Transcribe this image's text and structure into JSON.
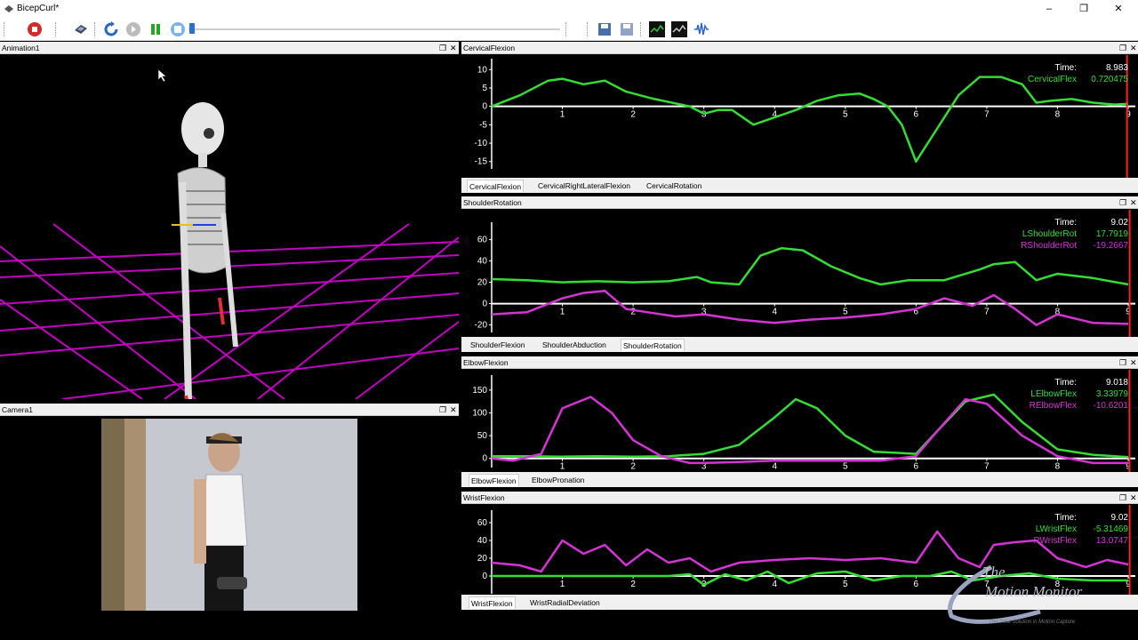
{
  "window": {
    "title": "BicepCurl*"
  },
  "colors": {
    "green": "#33dd33",
    "magenta": "#d633d6",
    "red": "#ff2020",
    "grid": "#c400c4"
  },
  "toolbar": {
    "icons": [
      "record-icon",
      "settings-tool-icon",
      "refresh-icon",
      "play-icon",
      "pause-icon",
      "stop-icon",
      "save-icon",
      "save-as-icon",
      "graph-icon",
      "graph-add-icon",
      "waveform-icon"
    ]
  },
  "panels": {
    "animation": {
      "title": "Animation1"
    },
    "camera": {
      "title": "Camera1"
    },
    "cervical": {
      "title": "CervicalFlexion",
      "time_label": "Time:",
      "time_value": "8.983",
      "legend": [
        {
          "name": "CervicalFlex",
          "value": "0.720475",
          "color": "#33dd33"
        }
      ],
      "tabs": [
        "CervicalFlexion",
        "CervicalRightLateralFlexion",
        "CervicalRotation"
      ],
      "active_tab": 0,
      "y_ticks": [
        "10",
        "5",
        "0",
        "-5",
        "-10",
        "-15"
      ],
      "x_ticks": [
        "1",
        "2",
        "3",
        "4",
        "5",
        "6",
        "7",
        "8",
        "9"
      ]
    },
    "shoulder": {
      "title": "ShoulderRotation",
      "time_label": "Time:",
      "time_value": "9.02",
      "legend": [
        {
          "name": "LShoulderRot",
          "value": "17.7919",
          "color": "#33dd33"
        },
        {
          "name": "RShoulderRot",
          "value": "-19.2667",
          "color": "#d633d6"
        }
      ],
      "tabs": [
        "ShoulderFlexion",
        "ShoulderAbduction",
        "ShoulderRotation"
      ],
      "active_tab": 2,
      "y_ticks": [
        "60",
        "40",
        "20",
        "0",
        "-20"
      ],
      "x_ticks": [
        "1",
        "2",
        "3",
        "4",
        "5",
        "6",
        "7",
        "8",
        "9"
      ]
    },
    "elbow": {
      "title": "ElbowFlexion",
      "time_label": "Time:",
      "time_value": "9.018",
      "legend": [
        {
          "name": "LElbowFlex",
          "value": "3.33979",
          "color": "#33dd33"
        },
        {
          "name": "RElbowFlex",
          "value": "-10.6201",
          "color": "#d633d6"
        }
      ],
      "tabs": [
        "ElbowFlexion",
        "ElbowPronation"
      ],
      "active_tab": 0,
      "y_ticks": [
        "150",
        "100",
        "50",
        "0"
      ],
      "x_ticks": [
        "1",
        "2",
        "3",
        "4",
        "5",
        "6",
        "7",
        "8",
        "9"
      ]
    },
    "wrist": {
      "title": "WristFlexion",
      "time_label": "Time:",
      "time_value": "9.02",
      "legend": [
        {
          "name": "LWristFlex",
          "value": "-5.31469",
          "color": "#33dd33"
        },
        {
          "name": "RWristFlex",
          "value": "13.0747",
          "color": "#d633d6"
        }
      ],
      "tabs": [
        "WristFlexion",
        "WristRadialDeviation"
      ],
      "active_tab": 0,
      "y_ticks": [
        "60",
        "40",
        "20",
        "0"
      ],
      "x_ticks": [
        "1",
        "2",
        "3",
        "4",
        "5",
        "6",
        "7",
        "8",
        "9"
      ]
    }
  },
  "chart_data": [
    {
      "type": "line",
      "title": "CervicalFlexion",
      "xlim": [
        0,
        9
      ],
      "ylim": [
        -17,
        12
      ],
      "series": [
        {
          "name": "CervicalFlex",
          "x": [
            0,
            0.4,
            0.8,
            1.0,
            1.3,
            1.6,
            1.9,
            2.3,
            2.8,
            3.0,
            3.2,
            3.4,
            3.7,
            4.0,
            4.3,
            4.6,
            4.9,
            5.2,
            5.4,
            5.6,
            5.8,
            6.0,
            6.3,
            6.6,
            6.9,
            7.2,
            7.5,
            7.7,
            7.9,
            8.2,
            8.5,
            8.8,
            9.0
          ],
          "y": [
            0,
            3,
            7,
            7.5,
            6,
            7,
            4,
            2,
            0,
            -2,
            -1,
            -1,
            -5,
            -3,
            -1,
            1.5,
            3,
            3.5,
            2,
            0,
            -5,
            -15,
            -6,
            3,
            8,
            8,
            6,
            1,
            1.5,
            2,
            1,
            0.5,
            0.7
          ]
        }
      ]
    },
    {
      "type": "line",
      "title": "ShoulderRotation",
      "xlim": [
        0,
        9
      ],
      "ylim": [
        -27,
        73
      ],
      "series": [
        {
          "name": "LShoulderRot",
          "x": [
            0,
            0.5,
            1.0,
            1.5,
            2.0,
            2.5,
            2.9,
            3.1,
            3.5,
            3.8,
            4.1,
            4.4,
            4.8,
            5.2,
            5.5,
            5.9,
            6.4,
            6.9,
            7.1,
            7.4,
            7.7,
            8.0,
            8.5,
            9.0
          ],
          "y": [
            23,
            22,
            20,
            21,
            20,
            21,
            25,
            20,
            18,
            45,
            52,
            50,
            35,
            24,
            18,
            22,
            22,
            32,
            37,
            39,
            22,
            28,
            24,
            18
          ]
        },
        {
          "name": "RShoulderRot",
          "x": [
            0,
            0.5,
            1.0,
            1.3,
            1.6,
            1.9,
            2.2,
            2.6,
            3.0,
            3.5,
            4.0,
            4.5,
            5.0,
            5.5,
            6.0,
            6.4,
            6.8,
            7.1,
            7.4,
            7.7,
            8.0,
            8.5,
            9.0
          ],
          "y": [
            -10,
            -8,
            5,
            10,
            12,
            -5,
            -8,
            -12,
            -10,
            -15,
            -18,
            -15,
            -13,
            -10,
            -5,
            5,
            -2,
            8,
            -5,
            -20,
            -10,
            -18,
            -19
          ]
        }
      ]
    },
    {
      "type": "line",
      "title": "ElbowFlexion",
      "xlim": [
        0,
        9
      ],
      "ylim": [
        -20,
        175
      ],
      "series": [
        {
          "name": "LElbowFlex",
          "x": [
            0,
            0.5,
            1.0,
            1.5,
            2.0,
            2.5,
            3.0,
            3.5,
            4.0,
            4.3,
            4.6,
            5.0,
            5.4,
            6.0,
            6.3,
            6.7,
            7.1,
            7.5,
            8.0,
            8.5,
            9.0
          ],
          "y": [
            5,
            5,
            4,
            5,
            4,
            5,
            10,
            30,
            90,
            130,
            110,
            50,
            15,
            10,
            60,
            125,
            140,
            80,
            20,
            8,
            3
          ]
        },
        {
          "name": "RElbowFlex",
          "x": [
            0,
            0.3,
            0.7,
            1.0,
            1.4,
            1.7,
            2.0,
            2.4,
            2.8,
            3.0,
            3.5,
            4.0,
            4.5,
            5.0,
            5.5,
            6.0,
            6.3,
            6.7,
            7.0,
            7.5,
            8.0,
            8.5,
            9.0
          ],
          "y": [
            0,
            -5,
            10,
            110,
            135,
            100,
            40,
            5,
            -10,
            -10,
            -8,
            -5,
            -5,
            -5,
            -5,
            5,
            60,
            130,
            120,
            50,
            5,
            -10,
            -10
          ]
        }
      ]
    },
    {
      "type": "line",
      "title": "WristFlexion",
      "xlim": [
        0,
        9
      ],
      "ylim": [
        -20,
        70
      ],
      "series": [
        {
          "name": "LWristFlex",
          "x": [
            0,
            0.5,
            1.0,
            1.5,
            2.0,
            2.5,
            2.8,
            3.0,
            3.3,
            3.6,
            3.9,
            4.2,
            4.6,
            5.0,
            5.4,
            5.8,
            6.2,
            6.5,
            6.8,
            7.2,
            7.6,
            8.0,
            8.5,
            9.0
          ],
          "y": [
            0,
            0,
            0,
            0,
            0,
            0,
            2,
            -10,
            2,
            -5,
            5,
            -8,
            3,
            5,
            -5,
            0,
            0,
            5,
            -5,
            0,
            3,
            -3,
            -5,
            -5
          ]
        },
        {
          "name": "RWristFlex",
          "x": [
            0,
            0.4,
            0.7,
            1.0,
            1.3,
            1.6,
            1.9,
            2.2,
            2.5,
            2.8,
            3.1,
            3.5,
            4.0,
            4.5,
            5.0,
            5.5,
            6.0,
            6.3,
            6.6,
            6.9,
            7.1,
            7.4,
            7.7,
            8.0,
            8.4,
            8.7,
            9.0
          ],
          "y": [
            15,
            12,
            5,
            40,
            25,
            35,
            12,
            30,
            15,
            20,
            5,
            15,
            18,
            20,
            18,
            20,
            15,
            50,
            20,
            10,
            35,
            38,
            40,
            20,
            10,
            18,
            13
          ]
        }
      ]
    }
  ],
  "watermark": {
    "line1": "The",
    "line2": "Motion Monitor",
    "tagline": "The Total Solution in Motion Capture"
  }
}
